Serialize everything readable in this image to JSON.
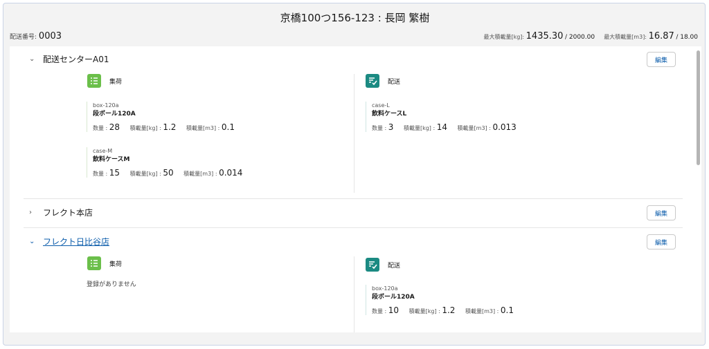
{
  "header": {
    "title": "京橋100つ156-123 : 長岡 繁樹",
    "delivery_no_label": "配送番号:",
    "delivery_no": "0003",
    "max_kg_label": "最大積載量[kg]:",
    "max_kg_value": "1435.30",
    "max_kg_limit": "/ 2000.00",
    "max_m3_label": "最大積載量[m3]:",
    "max_m3_value": "16.87",
    "max_m3_limit": "/ 18.00"
  },
  "labels": {
    "edit": "編集",
    "pickup": "集荷",
    "delivery": "配送",
    "qty": "数量 : ",
    "kg": "積載量[kg] : ",
    "m3": "積載量[m3] : ",
    "qty2": "数量 : ",
    "kg2": "積載量[kg] : ",
    "m3_2": "積載量[m3] : ",
    "empty": "登録がありません"
  },
  "sections": [
    {
      "name": "配送センターA01",
      "pickup": [
        {
          "code": "box-120a",
          "name": "段ボール120A",
          "qty": "28",
          "kg": "1.2",
          "m3": "0.1"
        },
        {
          "code": "case-M",
          "name": "飲料ケースM",
          "qty": "15",
          "kg": "50",
          "m3": "0.014"
        }
      ],
      "delivery": [
        {
          "code": "case-L",
          "name": "飲料ケースL",
          "qty": "3",
          "kg": "14",
          "m3": "0.013"
        }
      ]
    },
    {
      "name": "フレクト本店"
    },
    {
      "name": "フレクト日比谷店",
      "delivery": [
        {
          "code": "box-120a",
          "name": "段ボール120A",
          "qty": "10",
          "kg": "1.2",
          "m3": "0.1"
        }
      ]
    }
  ],
  "colors": {
    "pickup_icon": "#6bbf4a",
    "delivery_icon": "#1b8a82",
    "link": "#0b5cab"
  }
}
